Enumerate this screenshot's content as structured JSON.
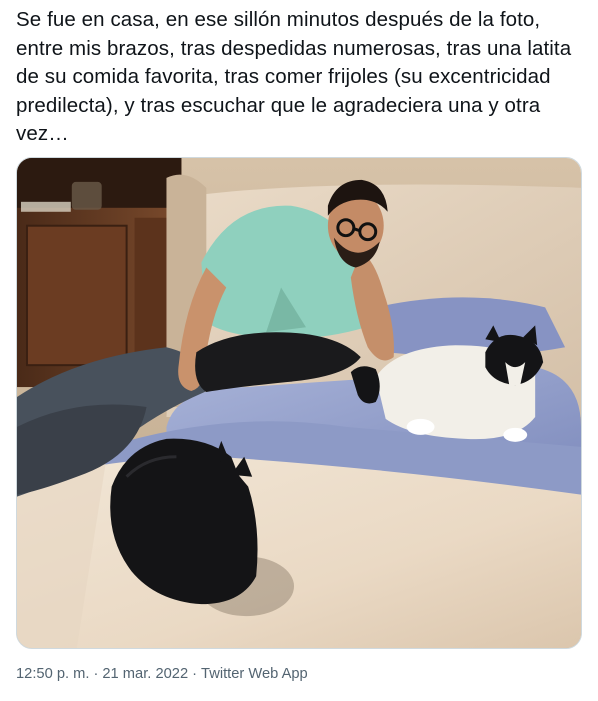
{
  "tweet": {
    "text": "Se fue en casa, en ese sillón minutos después de la foto, entre mis brazos, tras despedidas numerosas, tras una latita de su comida favorita, tras comer frijoles (su excentricidad predilecta), y tras escuchar que le agradeciera una y otra vez…",
    "time": "12:50 p. m.",
    "date": "21 mar. 2022",
    "separator": "·",
    "source": "Twitter Web App"
  },
  "media": {
    "alt": "photo",
    "colors": {
      "wall": "#cdb8a0",
      "cushion": "#e3d3c0",
      "blanket": "#8d9ac6",
      "cabinet": "#5b3420",
      "shirt": "#8fd0be",
      "jeans": "#3f4650",
      "black_cat": "#151517"
    }
  }
}
